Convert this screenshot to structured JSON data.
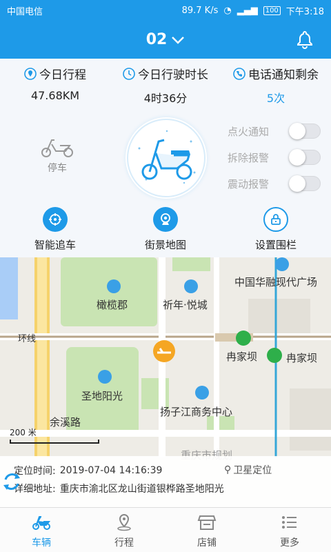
{
  "status_bar": {
    "carrier": "中国电信",
    "speed": "89.7 K/s",
    "battery": "100",
    "time": "下午3:18"
  },
  "header": {
    "title": "02",
    "chevron_icon": "chevron-down-icon",
    "bell_icon": "bell-icon"
  },
  "stats": [
    {
      "label": "今日行程",
      "value": "47.68KM",
      "icon": "location-pin-icon"
    },
    {
      "label": "今日行驶时长",
      "value": "4时36分",
      "icon": "clock-icon"
    },
    {
      "label": "电话通知剩余",
      "value": "5次",
      "icon": "phone-icon"
    }
  ],
  "vehicle": {
    "state": "停车"
  },
  "toggles": [
    {
      "label": "点火通知",
      "on": false
    },
    {
      "label": "拆除报警",
      "on": false
    },
    {
      "label": "震动报警",
      "on": false
    }
  ],
  "actions": [
    {
      "label": "智能追车",
      "icon": "target-icon"
    },
    {
      "label": "街景地图",
      "icon": "camera-icon"
    },
    {
      "label": "设置围栏",
      "icon": "lock-icon"
    }
  ],
  "map": {
    "labels": {
      "cbd": "中国华融现代广场",
      "ganlan": "橄榄郡",
      "xinnian": "祈年·悦城",
      "huanxian": "环线",
      "ranjiaba1": "冉家坝",
      "ranjiaba2": "冉家坝",
      "shengdi": "圣地阳光",
      "yangzijiang": "扬子江商务中心",
      "yuxi": "余溪路",
      "planning": "重庆市规划"
    },
    "scale": "200 米"
  },
  "location_info": {
    "time_label": "定位时间:",
    "time_value": "2019-07-04 14:16:39",
    "sat_label": "卫星定位",
    "addr_label": "详细地址:",
    "addr_value": "重庆市渝北区龙山街道银桦路圣地阳光"
  },
  "tabs": [
    {
      "label": "车辆",
      "icon": "scooter-icon",
      "active": true
    },
    {
      "label": "行程",
      "icon": "map-pin-icon",
      "active": false
    },
    {
      "label": "店铺",
      "icon": "store-icon",
      "active": false
    },
    {
      "label": "更多",
      "icon": "list-icon",
      "active": false
    }
  ],
  "colors": {
    "primary": "#1e9ae8",
    "green_station": "#2eaf4a",
    "marker": "#f5a623"
  }
}
